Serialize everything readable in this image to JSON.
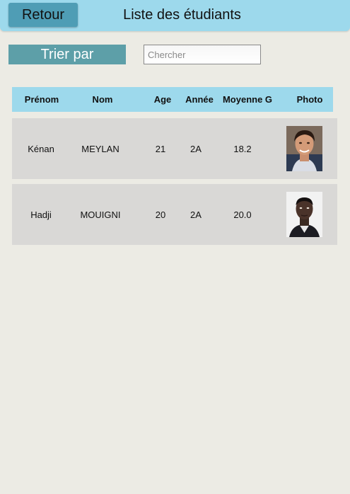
{
  "header": {
    "back_label": "Retour",
    "title": "Liste des étudiants"
  },
  "toolbar": {
    "sort_label": "Trier par",
    "search_placeholder": "Chercher"
  },
  "table": {
    "columns": [
      "Prénom",
      "Nom",
      "Age",
      "Année",
      "Moyenne G",
      "Photo"
    ],
    "rows": [
      {
        "prenom": "Kénan",
        "nom": "MEYLAN",
        "age": "21",
        "annee": "2A",
        "moyenne": "18.2",
        "photo": "student-photo-kenan"
      },
      {
        "prenom": "Hadji",
        "nom": "MOUIGNI",
        "age": "20",
        "annee": "2A",
        "moyenne": "20.0",
        "photo": "student-photo-hadji"
      }
    ]
  },
  "colors": {
    "header_bg": "#9dd9ec",
    "back_button": "#4f9db5",
    "sort_button": "#5d9fa8",
    "row_bg": "#d9d8d6",
    "page_bg": "#ecebe4"
  }
}
